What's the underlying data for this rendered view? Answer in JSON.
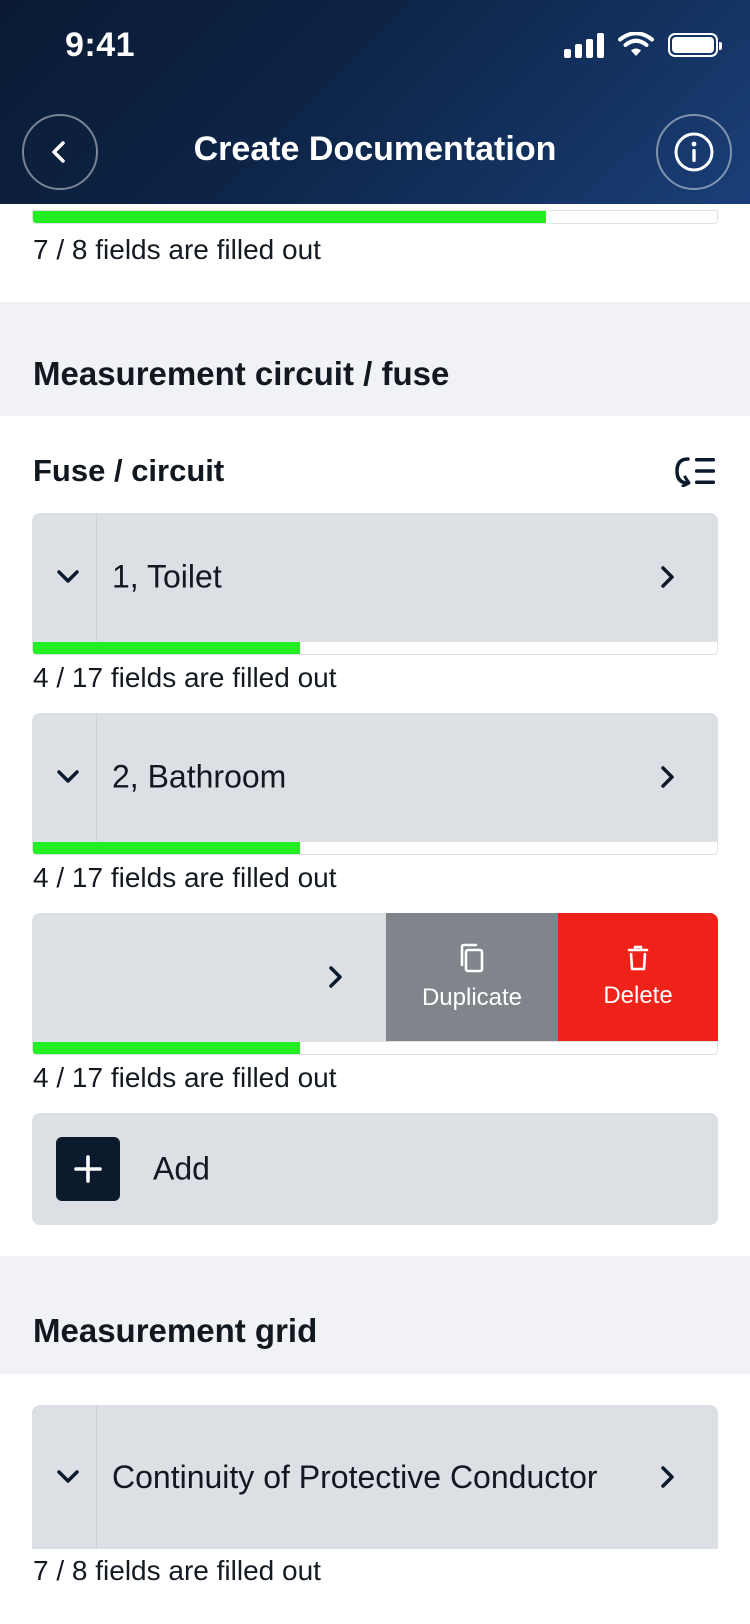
{
  "status_bar": {
    "time": "9:41"
  },
  "header": {
    "title": "Create Documentation"
  },
  "top_card": {
    "progress": 0.75,
    "fields_text": "7 / 8 fields are filled out"
  },
  "section_fuse": {
    "title": "Measurement circuit / fuse",
    "group_title": "Fuse / circuit",
    "items": [
      {
        "label": "1, Toilet",
        "progress": 0.39,
        "fields_text": "4 / 17 fields are filled out"
      },
      {
        "label": "2, Bathroom",
        "progress": 0.39,
        "fields_text": "4 / 17 fields are filled out"
      },
      {
        "label": "",
        "progress": 0.39,
        "fields_text": "4 / 17 fields are filled out"
      }
    ],
    "swipe_actions": {
      "duplicate": "Duplicate",
      "delete": "Delete"
    },
    "add_label": "Add"
  },
  "section_grid": {
    "title": "Measurement grid",
    "items": [
      {
        "label": "Continuity of Protective Conductor",
        "fields_text": "7 / 8 fields are filled out"
      }
    ]
  },
  "colors": {
    "progress": "#22ee22",
    "delete": "#ee2219",
    "duplicate": "#80858c",
    "header": "#0d2548"
  },
  "icons": [
    "back-arrow-icon",
    "info-icon",
    "toggle-list-icon",
    "chevron-down-icon",
    "chevron-right-icon",
    "copy-icon",
    "trash-icon",
    "plus-icon"
  ]
}
